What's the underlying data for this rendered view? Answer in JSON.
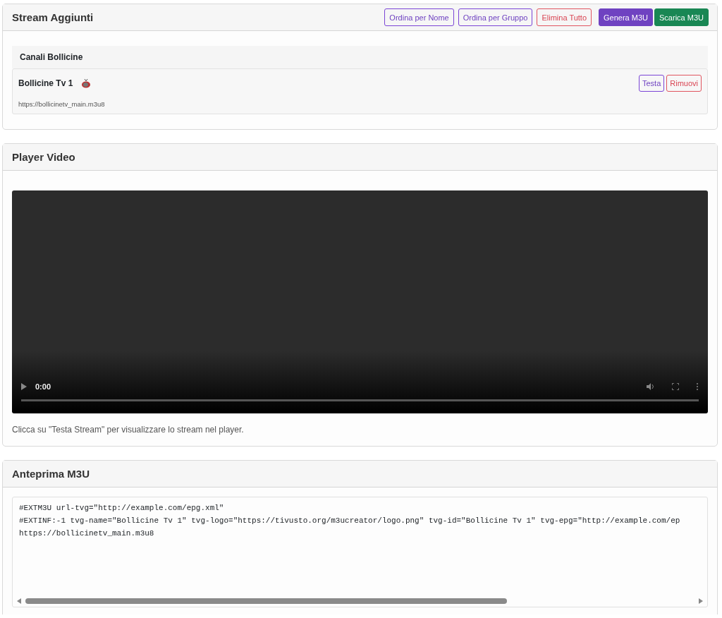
{
  "streams_panel": {
    "title": "Stream Aggiunti",
    "buttons": [
      {
        "label": "Ordina per Nome",
        "kind": "outline-purple"
      },
      {
        "label": "Ordina per Gruppo",
        "kind": "outline-purple"
      },
      {
        "label": "Elimina Tutto",
        "kind": "outline-red"
      },
      {
        "label": "Genera M3U",
        "kind": "solid-purple"
      },
      {
        "label": "Scarica M3U",
        "kind": "solid-green"
      }
    ],
    "groups": [
      {
        "name": "Canali Bollicine",
        "channels": [
          {
            "name": "Bollicine Tv 1",
            "url": "https://bollicinetv_main.m3u8",
            "buttons": [
              {
                "label": "Testa",
                "kind": "outline-purple"
              },
              {
                "label": "Rimuovi",
                "kind": "outline-red"
              }
            ]
          }
        ]
      }
    ]
  },
  "player_panel": {
    "title": "Player Video",
    "time": "0:00",
    "hint": "Clicca su \"Testa Stream\" per visualizzare lo stream nel player."
  },
  "preview_panel": {
    "title": "Anteprima M3U",
    "lines": [
      "#EXTM3U url-tvg=\"http://example.com/epg.xml\"",
      "#EXTINF:-1 tvg-name=\"Bollicine Tv 1\" tvg-logo=\"https://tivusto.org/m3ucreator/logo.png\" tvg-id=\"Bollicine Tv 1\" tvg-epg=\"http://example.com/ep",
      "https://bollicinetv_main.m3u8"
    ]
  }
}
